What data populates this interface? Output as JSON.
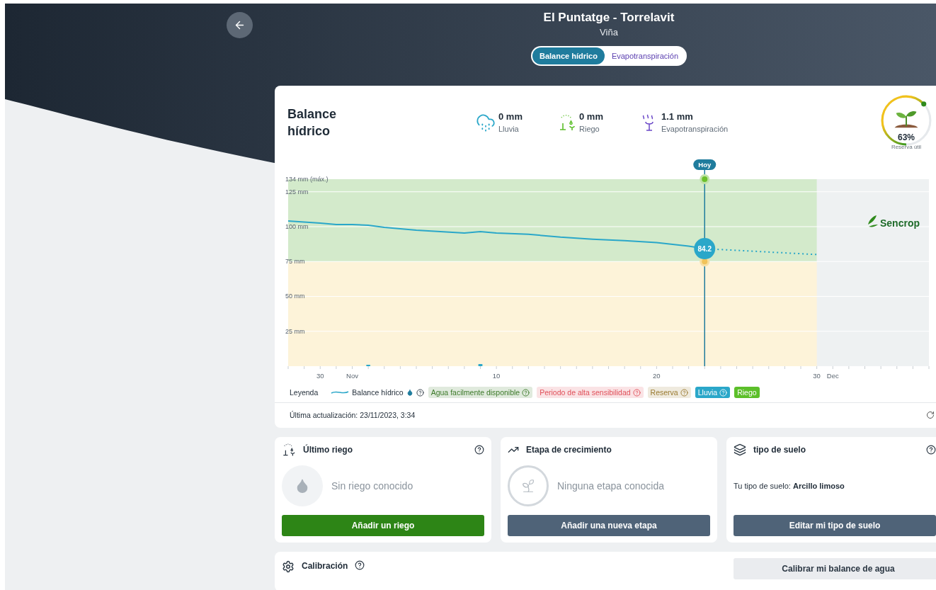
{
  "header": {
    "title": "El Puntatge - Torrelavit",
    "subtitle": "Viña"
  },
  "tabs": [
    {
      "label": "Balance hídrico",
      "selected": true
    },
    {
      "label": "Evapotranspiración",
      "selected": false
    }
  ],
  "balance_card": {
    "title": "Balance hídrico",
    "stats": [
      {
        "kind": "rain",
        "value": "0 mm",
        "label": "Lluvia"
      },
      {
        "kind": "irrigation",
        "value": "0 mm",
        "label": "Riego"
      },
      {
        "kind": "evapotranspiration",
        "value": "1.1 mm",
        "label": "Evapotranspiración"
      }
    ],
    "reserve": {
      "level": 0.63,
      "value": "63%",
      "label": "Reserva útil"
    },
    "chart_data": {
      "type": "line",
      "x": [
        "2023-10-28",
        "2023-10-30",
        "2023-10-31",
        "2023-11-01",
        "2023-11-02",
        "2023-11-03",
        "2023-11-05",
        "2023-11-08",
        "2023-11-09",
        "2023-11-10",
        "2023-11-12",
        "2023-11-14",
        "2023-11-16",
        "2023-11-18",
        "2023-11-20",
        "2023-11-22",
        "2023-11-23",
        "2023-11-30"
      ],
      "xlim": [
        "2023-10-28",
        "2023-12-07"
      ],
      "ylim": [
        0,
        134
      ],
      "xticks": [
        {
          "value": "2023-10-30",
          "label": "30"
        },
        {
          "value": "2023-11-01",
          "label": "Nov"
        },
        {
          "value": "2023-11-10",
          "label": "10"
        },
        {
          "value": "2023-11-20",
          "label": "20"
        },
        {
          "value": "2023-11-30",
          "label": "30"
        },
        {
          "value": "2023-12-01",
          "label": "Dec"
        }
      ],
      "yticks": [
        {
          "value": 134,
          "label": "134 mm (máx.)"
        },
        {
          "value": 125,
          "label": "125 mm"
        },
        {
          "value": 100,
          "label": "100 mm"
        },
        {
          "value": 75,
          "label": "75 mm"
        },
        {
          "value": 50,
          "label": "50 mm"
        },
        {
          "value": 25,
          "label": "25 mm"
        }
      ],
      "series": [
        {
          "type": "line",
          "color": "#2aa7c9",
          "values": [
            104,
            102.5,
            101.5,
            101.5,
            101,
            99.5,
            97.5,
            95.5,
            96.5,
            95.5,
            94.5,
            92.5,
            91,
            90,
            88.5,
            86,
            84.2,
            80
          ]
        },
        {
          "type": "bar",
          "color": "#2aa7c9",
          "values": [
            null,
            null,
            null,
            null,
            1,
            null,
            null,
            null,
            1.5,
            null,
            null,
            null,
            null,
            null,
            null,
            null,
            null,
            null
          ]
        }
      ],
      "grid": true,
      "bands": [
        {
          "axis": "y",
          "from": 75,
          "to": 134,
          "color": "#d3eacb"
        },
        {
          "axis": "y",
          "from": 0,
          "to": 75,
          "color": "#fdf3d9"
        },
        {
          "axis": "x",
          "from": "2023-11-30",
          "to": "2023-12-07",
          "color": "#eef1f2"
        }
      ],
      "annotations": [
        {
          "x": "2023-11-23",
          "text": "Hoy"
        },
        {
          "x": "2023-11-23",
          "y": 84.2,
          "text": "84.2"
        }
      ]
    },
    "logo": "Sencrop",
    "legend": {
      "title": "Leyenda",
      "items": [
        {
          "kind": "line",
          "label": "Balance hídrico",
          "color": "#2aa7c9",
          "help": true
        },
        {
          "kind": "zone",
          "label": "Agua facilmente disponible",
          "color": "#3d7a2a",
          "help": true
        },
        {
          "kind": "zone",
          "label": "Periodo de alta sensibilidad",
          "color": "#e0505a",
          "help": true
        },
        {
          "kind": "zone",
          "label": "Reserva",
          "color": "#9a7a30",
          "help": true
        },
        {
          "kind": "bar",
          "label": "Lluvia",
          "color": "#2aa7c9",
          "help": true
        },
        {
          "kind": "bar",
          "label": "Riego",
          "color": "#5cbf2a",
          "help": false
        }
      ]
    },
    "last_update": "Última actualización: 23/11/2023, 3:34"
  },
  "cards": [
    {
      "kind": "irrigation",
      "title": "Último riego",
      "help": true,
      "text": "Sin riego conocido",
      "button": "Añadir un riego"
    },
    {
      "kind": "growth",
      "title": "Etapa de crecimiento",
      "help": false,
      "text": "Ninguna etapa conocida",
      "button": "Añadir una nueva etapa"
    },
    {
      "kind": "soil",
      "title": "tipo de suelo",
      "help": true,
      "text": "Tu tipo de suelo: **Arcillo limoso**",
      "button": "Editar mi tipo de suelo"
    }
  ],
  "calibration": {
    "title": "Calibración",
    "help": true,
    "button": "Calibrar mi balance de agua"
  }
}
